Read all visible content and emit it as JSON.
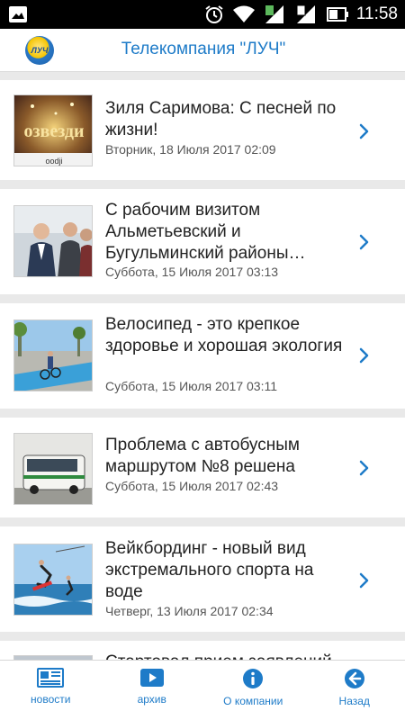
{
  "status_bar": {
    "time": "11:58"
  },
  "app": {
    "title": "Телекомпания \"ЛУЧ\"",
    "logo_text": "ЛУЧ"
  },
  "colors": {
    "accent": "#1e7bc8",
    "background": "#e9e9e9"
  },
  "feed": {
    "items": [
      {
        "headline": "Зиля Саримова: С песней по жизни!",
        "date": "Вторник, 18 Июля 2017 02:09",
        "thumb_text": "озвезди",
        "thumb_subtext": "oodji"
      },
      {
        "headline": "С рабочим визитом Альметьевский и Бугульминский районы…",
        "date": "Суббота, 15 Июля 2017 03:13"
      },
      {
        "headline": "Велосипед - это крепкое здоровье и хорошая экология",
        "date": "Суббота, 15 Июля 2017 03:11"
      },
      {
        "headline": "Проблема с автобусным маршрутом №8 решена",
        "date": "Суббота, 15 Июля 2017 02:43"
      },
      {
        "headline": "Вейкбординг - новый вид экстремального спорта на воде",
        "date": "Четверг, 13 Июля 2017 02:34"
      },
      {
        "headline": "Стартовал прием заявлений",
        "date": ""
      }
    ]
  },
  "bottom_nav": {
    "items": [
      {
        "label": "новости",
        "icon": "newspaper-icon"
      },
      {
        "label": "архив",
        "icon": "play-icon"
      },
      {
        "label": "О компании",
        "icon": "info-icon"
      },
      {
        "label": "Назад",
        "icon": "back-arrow-icon"
      }
    ]
  }
}
